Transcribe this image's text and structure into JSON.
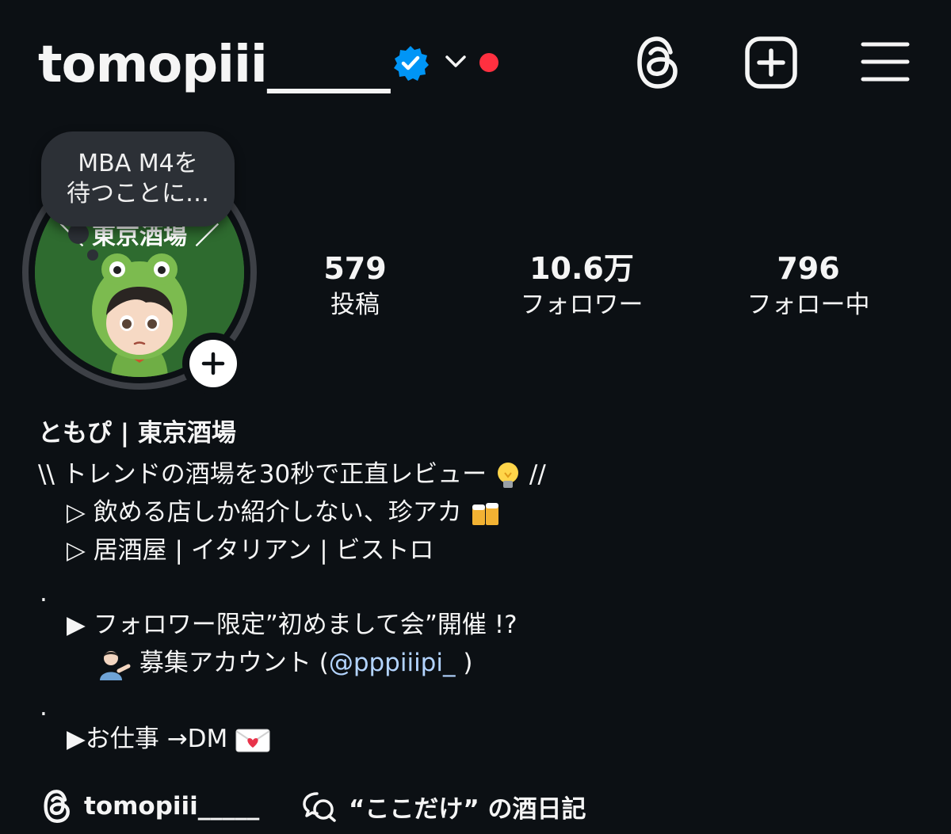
{
  "header": {
    "username": "tomopiii_____",
    "colors": {
      "verified": "#0095f6",
      "notification_dot": "#ff3040"
    }
  },
  "note": {
    "line1": "MBA M4を",
    "line2": "待つことに…"
  },
  "avatar": {
    "sign_text": "＼ 東京酒場 ／"
  },
  "stats": [
    {
      "value": "579",
      "label": "投稿"
    },
    {
      "value": "10.6万",
      "label": "フォロワー"
    },
    {
      "value": "796",
      "label": "フォロー中"
    }
  ],
  "bio": {
    "display_name": "ともぴ | 東京酒場",
    "line1": "\\\\ トレンドの酒場を30秒で正直レビュー",
    "line1_end": " //",
    "line2": "▷ 飲める店しか紹介しない、珍アカ",
    "line3": "▷ 居酒屋 | イタリアン | ビストロ",
    "dot1": ".",
    "line4": "▶ フォロワー限定”初めまして会”開催 !?",
    "line5_prefix": "募集アカウント (",
    "line5_mention": "@pppiiipi_",
    "line5_suffix": " )",
    "dot2": ".",
    "line6": "▶お仕事 →DM"
  },
  "bottom_links": {
    "threads_handle": "tomopiii_____",
    "channel_name": "“ここだけ” の酒日記"
  },
  "icons": [
    "verified-badge-icon",
    "chevron-down-icon",
    "threads-icon",
    "create-icon",
    "menu-icon",
    "plus-icon",
    "lightbulb-icon",
    "beer-icon",
    "person-tipping-hand-icon",
    "love-letter-icon",
    "broadcast-icon"
  ]
}
